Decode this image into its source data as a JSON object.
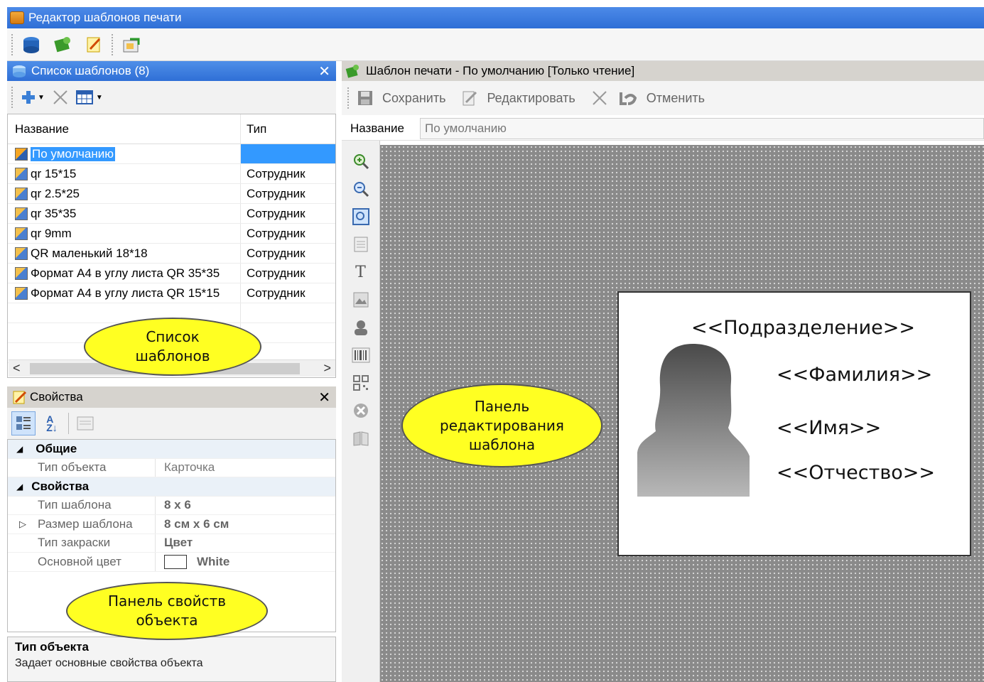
{
  "window": {
    "title": "Редактор шаблонов печати"
  },
  "main_toolbar": {
    "icons": [
      "database-icon",
      "template-green-icon",
      "edit-note-icon",
      "export-icon"
    ]
  },
  "template_list": {
    "header": "Список шаблонов (8)",
    "toolbar_icons": [
      "add-icon",
      "delete-icon",
      "view-icon"
    ],
    "columns": [
      "Название",
      "Тип"
    ],
    "rows": [
      {
        "name": "По умолчанию",
        "type": "",
        "selected": true
      },
      {
        "name": "qr 15*15",
        "type": "Сотрудник"
      },
      {
        "name": "qr 2.5*25",
        "type": "Сотрудник"
      },
      {
        "name": "qr 35*35",
        "type": "Сотрудник"
      },
      {
        "name": "qr 9mm",
        "type": "Сотрудник"
      },
      {
        "name": "QR маленький 18*18",
        "type": "Сотрудник"
      },
      {
        "name": "Формат А4 в углу листа QR 35*35",
        "type": "Сотрудник"
      },
      {
        "name": "Формат А4 в углу листа QR 15*15",
        "type": "Сотрудник"
      }
    ],
    "scroll_left": "<",
    "scroll_right": ">"
  },
  "properties": {
    "header": "Свойства",
    "groups": [
      {
        "name": "Общие",
        "rows": [
          {
            "name": "Тип объекта",
            "value": "Карточка"
          }
        ]
      },
      {
        "name": "Свойства",
        "rows": [
          {
            "name": "Тип шаблона",
            "value": "8 x 6"
          },
          {
            "name": "Размер шаблона",
            "value": "8 см x 6 см"
          },
          {
            "name": "Тип закраски",
            "value": "Цвет"
          },
          {
            "name": "Основной цвет",
            "value": "White"
          }
        ]
      }
    ],
    "description_title": "Тип объекта",
    "description_text": "Задает основные свойства объекта"
  },
  "editor": {
    "header": "Шаблон печати - По умолчанию [Только чтение]",
    "toolbar": {
      "save": "Сохранить",
      "edit": "Редактировать",
      "cancel": "Отменить"
    },
    "name_label": "Название",
    "name_value": "По умолчанию",
    "tools": [
      "zoom-in-icon",
      "zoom-out-icon",
      "zoom-fit-icon",
      "page-icon",
      "text-tool-icon",
      "image-tool-icon",
      "photo-tool-icon",
      "barcode-tool-icon",
      "qr-tool-icon",
      "delete-tool-icon",
      "book-tool-icon"
    ],
    "text_tool_glyph": "T",
    "card_fields": {
      "department": "<<Подразделение>>",
      "surname": "<<Фамилия>>",
      "name": "<<Имя>>",
      "patronymic": "<<Отчество>>"
    }
  },
  "callouts": {
    "list": [
      "Список",
      "шаблонов"
    ],
    "editor": [
      "Панель",
      "редактирования",
      "шаблона"
    ],
    "props": [
      "Панель свойств",
      "объекта"
    ]
  },
  "colors": {
    "title_blue": "#2f6fd6",
    "selection": "#3399ff",
    "callout_yellow": "#ffff22",
    "canvas_gray": "#8a8a8a"
  }
}
